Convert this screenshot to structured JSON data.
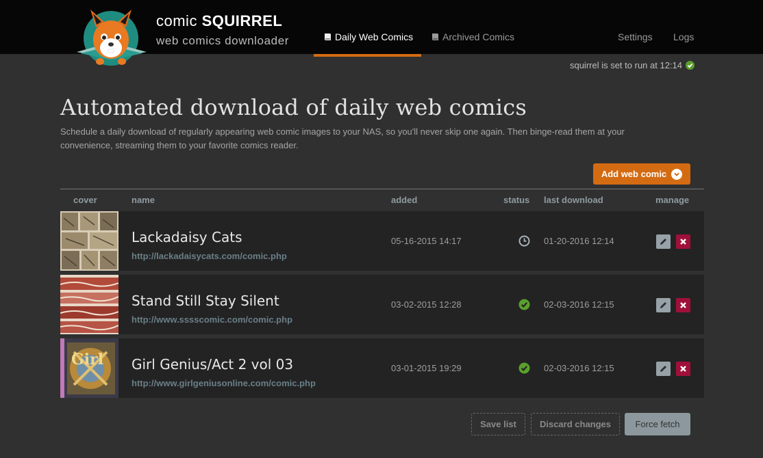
{
  "brand": {
    "title_light": "comic",
    "title_bold": "SQUIRREL",
    "subtitle": "web comics downloader"
  },
  "nav": {
    "tabs": [
      {
        "label": "Daily Web Comics",
        "active": true
      },
      {
        "label": "Archived Comics",
        "active": false
      }
    ],
    "settings": "Settings",
    "logs": "Logs"
  },
  "schedule_text": "squirrel is set to run at 12:14",
  "page": {
    "title": "Automated download of daily web comics",
    "intro": "Schedule a daily download of regularly appearing web comic images to your NAS, so you'll never skip one again. Then binge-read them at your convenience, streaming them to your favorite comics reader."
  },
  "add_button": "Add web comic",
  "table": {
    "headers": {
      "cover": "cover",
      "name": "name",
      "added": "added",
      "status": "status",
      "last_download": "last download",
      "manage": "manage"
    },
    "rows": [
      {
        "name": "Lackadaisy Cats",
        "url": "http://lackadaisycats.com/comic.php",
        "added": "05-16-2015 14:17",
        "status": "pending",
        "last_download": "01-20-2016 12:14"
      },
      {
        "name": "Stand Still Stay Silent",
        "url": "http://www.sssscomic.com/comic.php",
        "added": "03-02-2015 12:28",
        "status": "ok",
        "last_download": "02-03-2016 12:15"
      },
      {
        "name": "Girl Genius/Act 2 vol 03",
        "url": "http://www.girlgeniusonline.com/comic.php",
        "added": "03-01-2015 19:29",
        "status": "ok",
        "last_download": "02-03-2016 12:15"
      }
    ]
  },
  "footer_buttons": {
    "save": "Save list",
    "discard": "Discard changes",
    "force": "Force fetch"
  },
  "colors": {
    "accent": "#d36b12",
    "ok": "#5aa02c",
    "delete": "#a0103a",
    "edit": "#96a2a7"
  }
}
